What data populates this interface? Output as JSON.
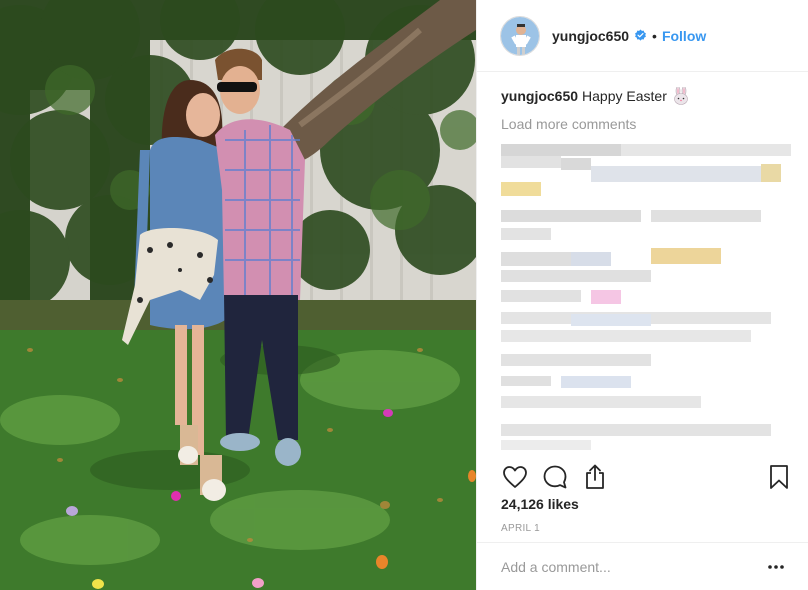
{
  "post": {
    "username": "yungjoc650",
    "verified": true,
    "separator": "•",
    "follow_label": "Follow",
    "caption_user": "yungjoc650",
    "caption_text": "Happy Easter",
    "caption_emoji": "bunny-face-icon",
    "load_more_label": "Load more comments",
    "likes": "24,126 likes",
    "date": "APRIL 1",
    "comment_placeholder": "Add a comment..."
  },
  "icons": {
    "verified": "verified-badge-icon",
    "like": "heart-outline-icon",
    "comment": "speech-bubble-icon",
    "share": "share-upload-icon",
    "save": "bookmark-icon",
    "more": "more-options-icon"
  },
  "colors": {
    "follow_blue": "#3897f0",
    "muted_gray": "#999999",
    "text": "#262626",
    "divider": "#efefef"
  }
}
